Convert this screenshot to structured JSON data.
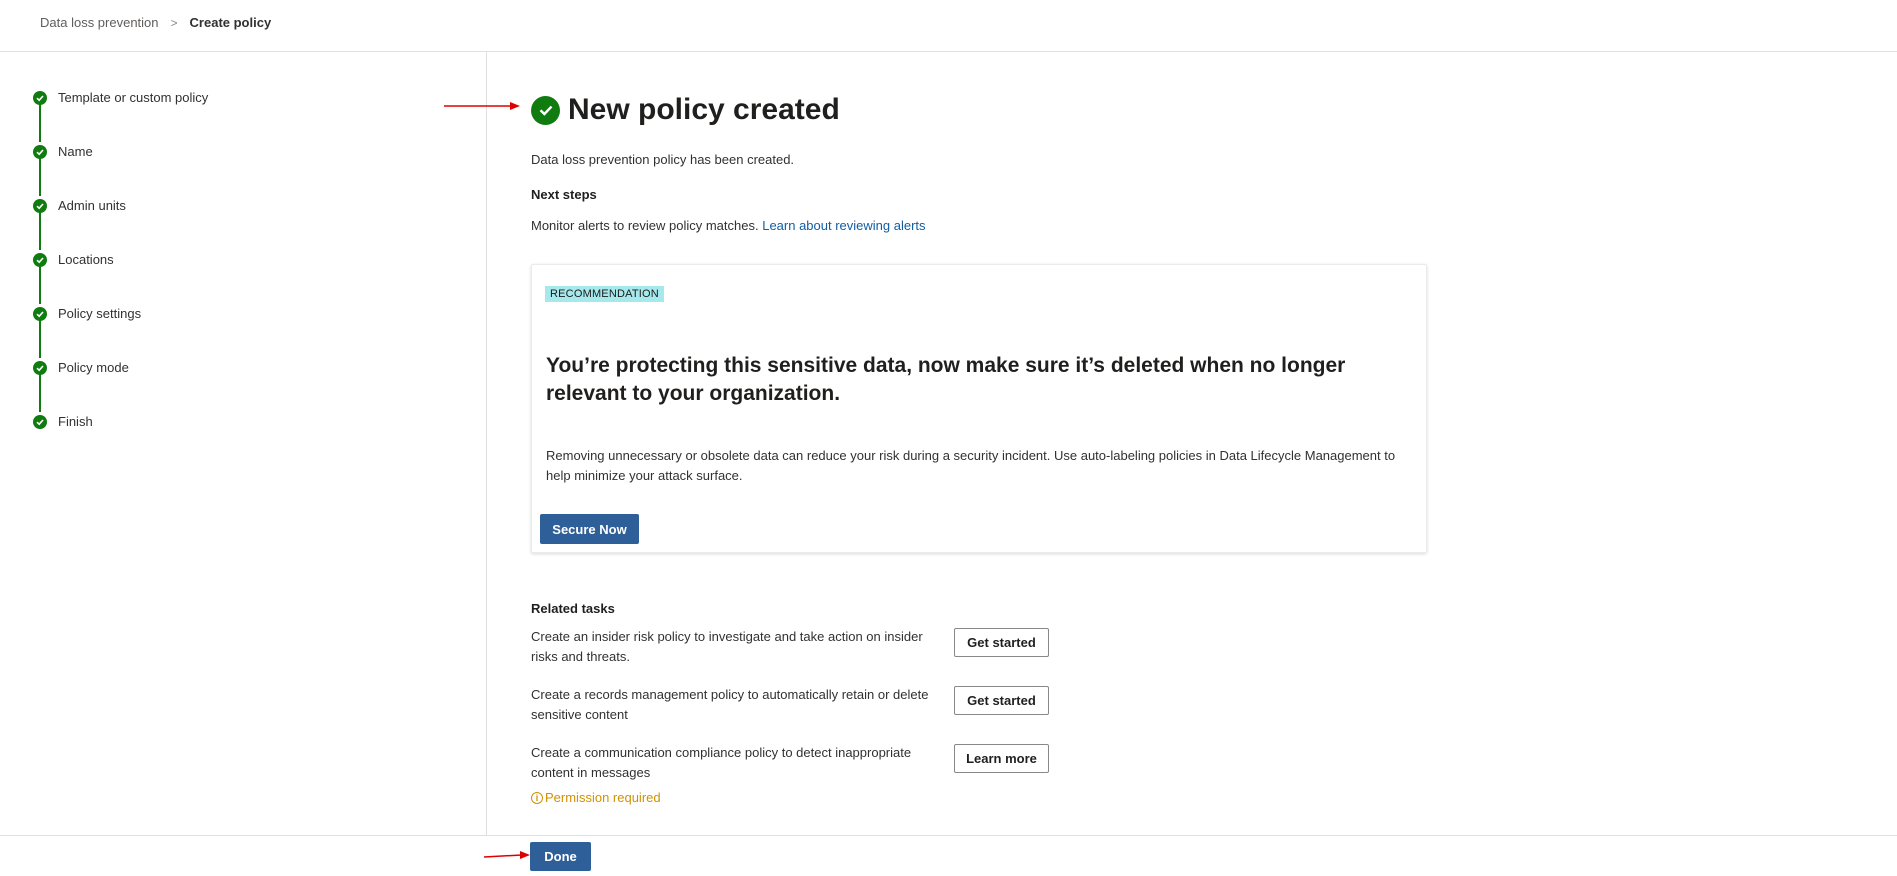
{
  "breadcrumb": {
    "parent": "Data loss prevention",
    "separator": ">",
    "current": "Create policy"
  },
  "stepper": {
    "steps": [
      {
        "label": "Template or custom policy",
        "status": "completed"
      },
      {
        "label": "Name",
        "status": "completed"
      },
      {
        "label": "Admin units",
        "status": "completed"
      },
      {
        "label": "Locations",
        "status": "completed"
      },
      {
        "label": "Policy settings",
        "status": "completed"
      },
      {
        "label": "Policy mode",
        "status": "completed"
      },
      {
        "label": "Finish",
        "status": "completed"
      }
    ]
  },
  "main": {
    "title": "New policy created",
    "title_icon": "check-circle-icon",
    "created_message": "Data loss prevention policy has been created.",
    "next_steps_heading": "Next steps",
    "monitor_text": "Monitor alerts to review policy matches.",
    "monitor_link": "Learn about reviewing alerts"
  },
  "recommendation": {
    "badge": "RECOMMENDATION",
    "heading": "You’re protecting this sensitive data, now make sure it’s deleted when no longer relevant to your organization.",
    "body": "Removing unnecessary or obsolete data can reduce your risk during a security incident. Use auto-labeling policies in Data Lifecycle Management to help minimize your attack surface.",
    "button": "Secure Now"
  },
  "related": {
    "heading": "Related tasks",
    "tasks": [
      {
        "text": "Create an insider risk policy to investigate and take action on insider risks and threats.",
        "button": "Get started"
      },
      {
        "text": "Create a records management policy to automatically retain or delete sensitive content",
        "button": "Get started"
      },
      {
        "text": "Create a communication compliance policy to detect inappropriate content in messages",
        "button": "Learn more"
      }
    ],
    "permission_icon": "info-icon",
    "permission_text": "Permission required"
  },
  "footer": {
    "done_label": "Done"
  },
  "colors": {
    "success": "#107c10",
    "primary": "#2f5f98",
    "link": "#115ea3",
    "warning": "#d29200",
    "badge_bg": "#a6e9ed",
    "annotation_arrow": "#e00000"
  }
}
